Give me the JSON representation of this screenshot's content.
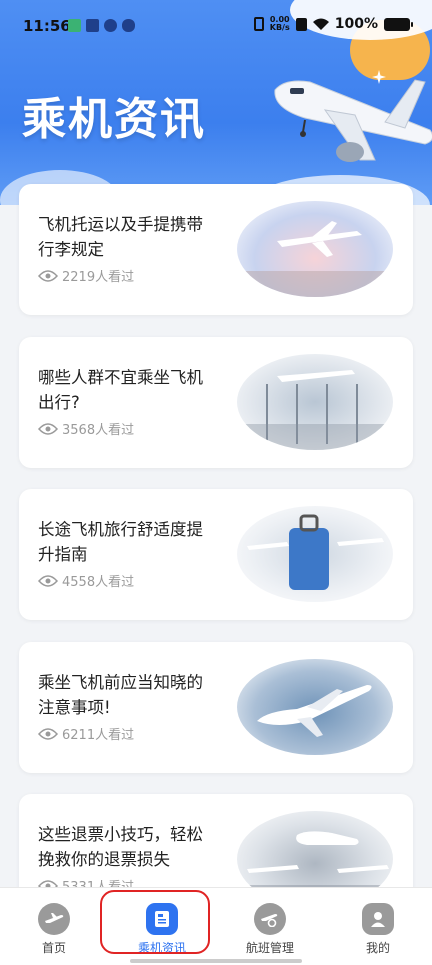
{
  "status_bar": {
    "time": "11:56",
    "net_speed": "0.00\nKB/s",
    "battery": "100%"
  },
  "header": {
    "title": "乘机资讯"
  },
  "articles": [
    {
      "title": "飞机托运以及手提携带行李规定",
      "views": "2219人看过"
    },
    {
      "title": "哪些人群不宜乘坐飞机出行?",
      "views": "3568人看过"
    },
    {
      "title": "长途飞机旅行舒适度提升指南",
      "views": "4558人看过"
    },
    {
      "title": "乘坐飞机前应当知晓的注意事项!",
      "views": "6211人看过"
    },
    {
      "title": "这些退票小技巧，轻松挽救你的退票损失",
      "views": "5331人看过"
    }
  ],
  "tabs": [
    {
      "label": "首页",
      "icon": "plane-icon"
    },
    {
      "label": "乘机资讯",
      "icon": "news-icon"
    },
    {
      "label": "航班管理",
      "icon": "flight-manage-icon"
    },
    {
      "label": "我的",
      "icon": "user-icon"
    }
  ],
  "colors": {
    "header_blue": "#3c7fee",
    "active_tab": "#2e73f0",
    "highlight_box": "#e02424"
  }
}
